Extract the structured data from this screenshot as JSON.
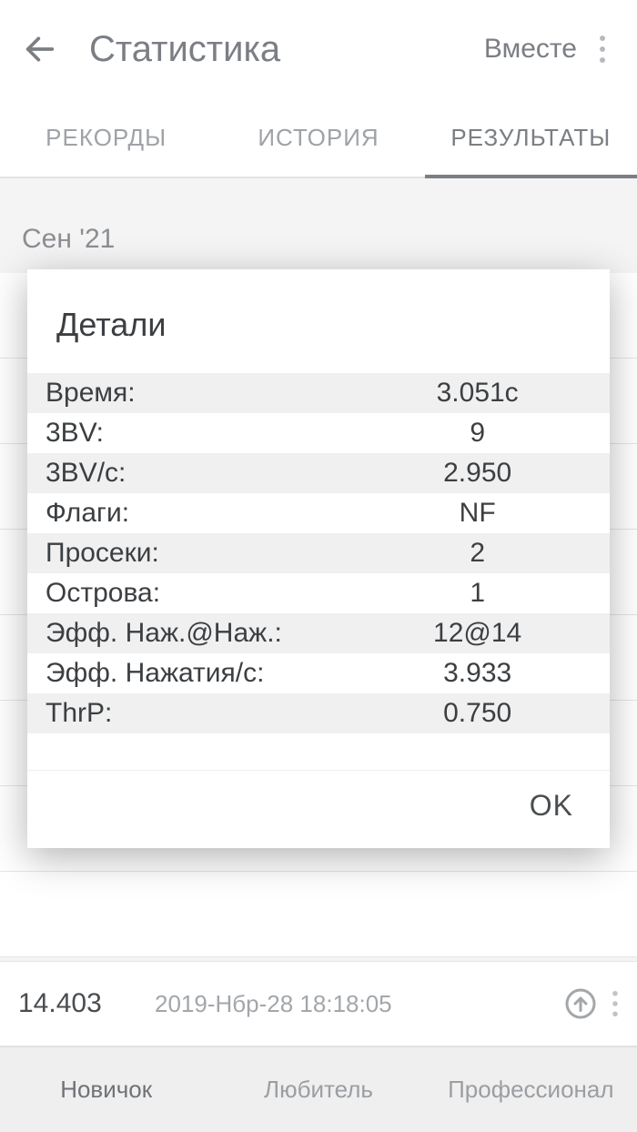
{
  "header": {
    "title": "Статистика",
    "action": "Вместе"
  },
  "tabsTop": {
    "records": "РЕКОРДЫ",
    "history": "ИСТОРИЯ",
    "results": "РЕЗУЛЬТАТЫ"
  },
  "monthLabel": "Сен '21",
  "lastRow": {
    "time": "14.403",
    "date": "2019-Нбр-28 18:18:05"
  },
  "tabsBottom": {
    "beginner": "Новичок",
    "intermediate": "Любитель",
    "expert": "Профессионал"
  },
  "dialog": {
    "title": "Детали",
    "rows": [
      {
        "k": "Время:",
        "v": "3.051с"
      },
      {
        "k": "3BV:",
        "v": "9"
      },
      {
        "k": "3BV/с:",
        "v": "2.950"
      },
      {
        "k": "Флаги:",
        "v": "NF"
      },
      {
        "k": "Просеки:",
        "v": "2"
      },
      {
        "k": "Острова:",
        "v": "1"
      },
      {
        "k": "Эфф. Наж.@Наж.:",
        "v": "12@14"
      },
      {
        "k": "Эфф. Нажатия/с:",
        "v": "3.933"
      },
      {
        "k": "ThrP:",
        "v": "0.750"
      }
    ],
    "ok": "OK"
  }
}
